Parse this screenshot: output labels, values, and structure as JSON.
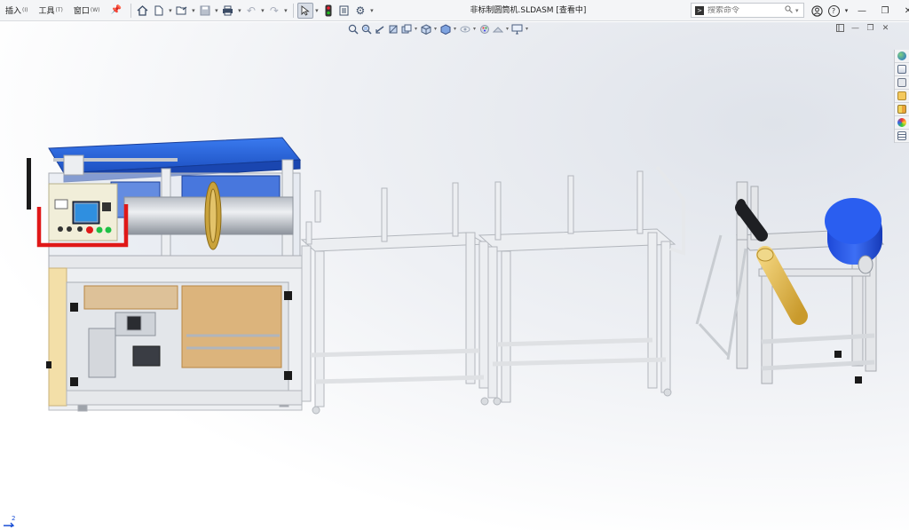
{
  "menu": {
    "items": [
      {
        "label": "插入",
        "accel": "(I)"
      },
      {
        "label": "工具",
        "accel": "(T)"
      },
      {
        "label": "窗口",
        "accel": "(W)"
      }
    ],
    "pin": "📌"
  },
  "document": {
    "title": "非标制圆筒机.SLDASM [查看中]"
  },
  "search": {
    "placeholder": "搜索命令"
  },
  "icons": {
    "home": "⌂",
    "new": "🗋",
    "open": "📂",
    "save": "💾",
    "print": "🖶",
    "undo": "↶",
    "redo": "↷",
    "select": "↖",
    "rebuild": "●",
    "file-props": "▤",
    "options": "⚙",
    "dropdown": "▾",
    "user": "◯",
    "help": "?",
    "minimize": "—",
    "restore": "❐",
    "close": "✕",
    "search": "🔍"
  },
  "window_controls": {
    "help_label": "?"
  },
  "triad": {
    "label": "2"
  },
  "colors": {
    "frame": "#e9eaec",
    "frame_edge": "#b8bbc0",
    "blue": "#1f5fd9",
    "panel": "#d9a95c",
    "red": "#e01818",
    "dark": "#2b2d33",
    "yellow": "#e9c251"
  }
}
